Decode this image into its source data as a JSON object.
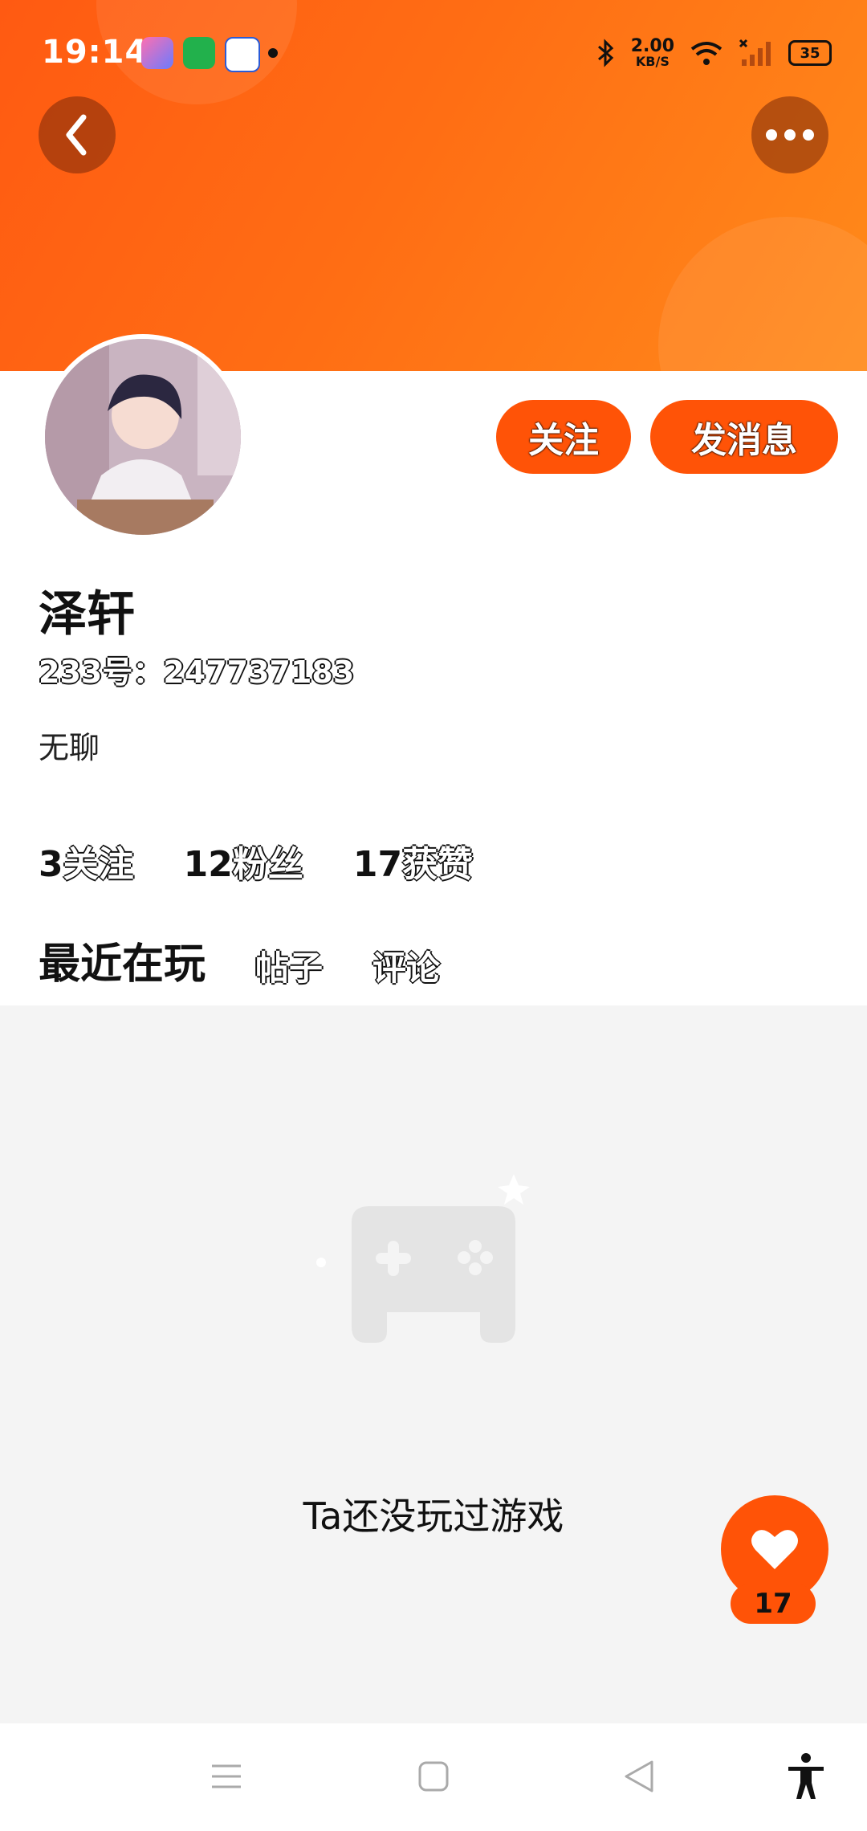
{
  "status_bar": {
    "time": "19:14",
    "net_speed": "2.00",
    "net_unit": "KB/S",
    "battery": "35",
    "icons": [
      "app-icon-1",
      "app-icon-2",
      "baidu-icon",
      "notification-dot",
      "bluetooth-icon",
      "wifi-icon",
      "signal-icon",
      "battery-icon"
    ]
  },
  "header": {
    "back_icon": "chevron-left-icon",
    "more_icon": "more-horizontal-icon"
  },
  "profile": {
    "name": "泽轩",
    "uid": "233号：247737183",
    "bio": "无聊",
    "follow_button": "关注",
    "message_button": "发消息"
  },
  "stats": {
    "following_num": "3",
    "following_label": "关注",
    "fans_num": "12",
    "fans_label": "粉丝",
    "likes_num": "17",
    "likes_label": "获赞"
  },
  "tabs": [
    {
      "label": "最近在玩",
      "active": true
    },
    {
      "label": "帖子",
      "active": false
    },
    {
      "label": "评论",
      "active": false
    }
  ],
  "empty_state": {
    "icon": "gamepad-icon",
    "text": "Ta还没玩过游戏"
  },
  "like_fab": {
    "icon": "heart-icon",
    "count": "17"
  },
  "colors": {
    "brand": "#ff5307",
    "banner_start": "#ff5a12",
    "banner_end": "#ff8a1a",
    "empty_bg": "#f4f4f4"
  },
  "nav_bar": {
    "icons": [
      "menu-icon",
      "home-square-icon",
      "back-triangle-icon",
      "accessibility-icon"
    ]
  }
}
